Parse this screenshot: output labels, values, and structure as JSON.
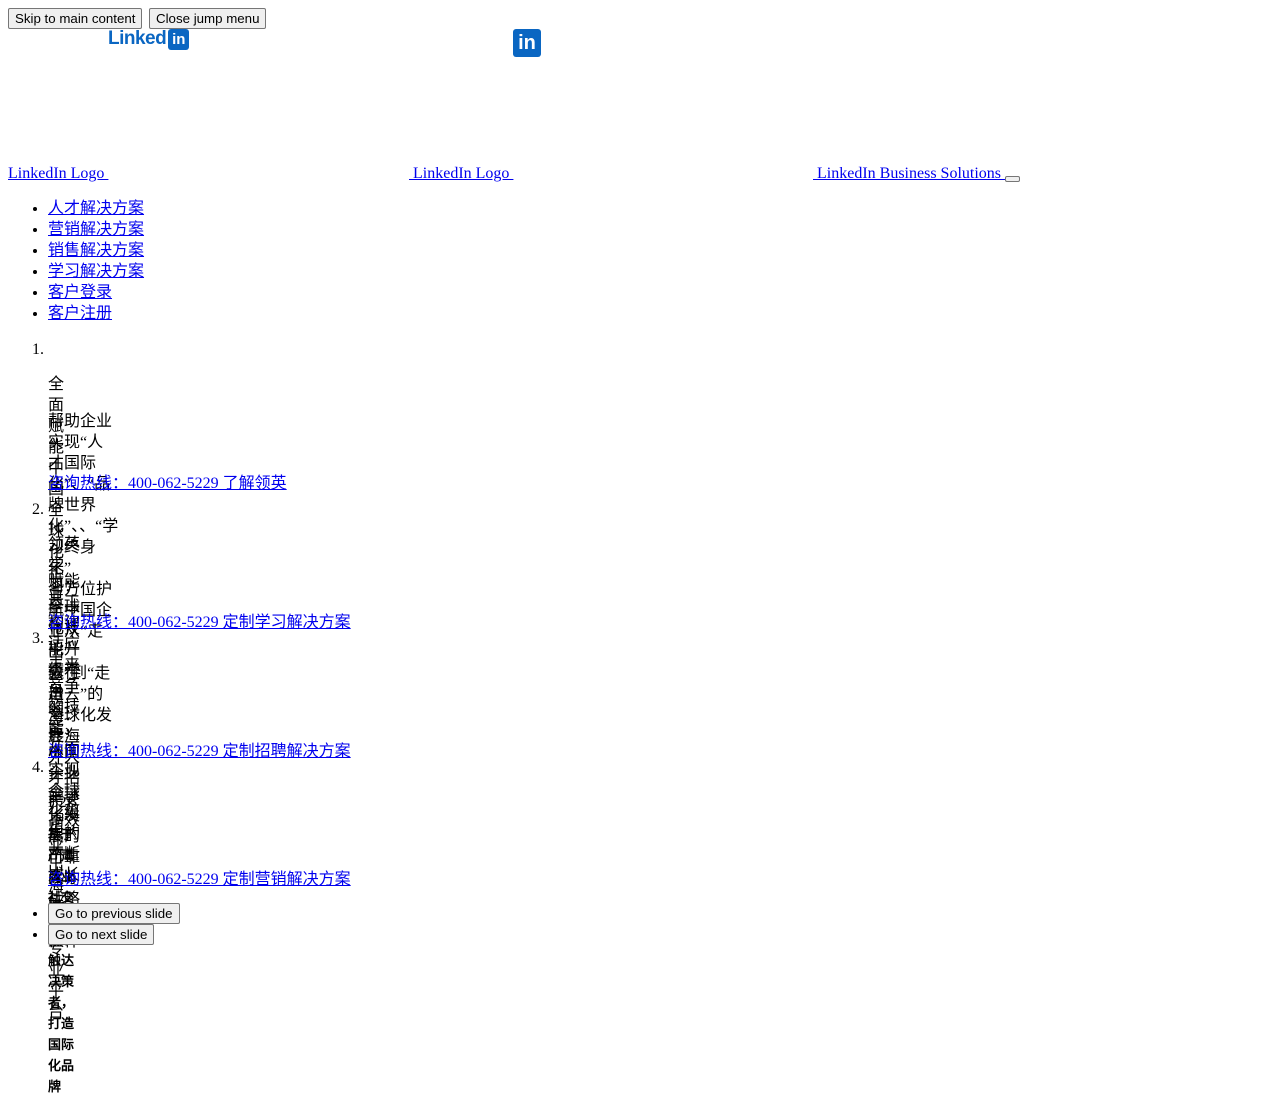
{
  "top_buttons": {
    "skip": "Skip to main content",
    "close_jump": "Close jump menu"
  },
  "brand": {
    "wordmark_text": "Linked",
    "wordmark_in": "in",
    "icon_in": "in",
    "color": "#0a66c2"
  },
  "logo_links": [
    "LinkedIn Logo ",
    " LinkedIn Logo ",
    " LinkedIn Business Solutions "
  ],
  "nav": [
    "人才解决方案",
    "营销解决方案",
    "销售解决方案",
    "学习解决方案",
    "客户登录",
    "客户注册"
  ],
  "slides": [
    {
      "number": "1.",
      "heading": "全面赋能中国全球化企业",
      "desc_lines": [
        "帮助企业实现“人才国际化”、“品牌世界化”、、“学习终身化”",
        "全方位护航中国企业从“走出去”到“走进去”的全球化发展"
      ],
      "cta": "咨询热线：400-062-5229 了解领英"
    },
    {
      "number": "2.",
      "heading": "领英学习：全球化技能升级平台",
      "desc_lines": [
        "赋能员工构建适应未来竞争的技能，从而实现全球化组织的不断成长"
      ],
      "cta": "咨询热线：400-062-5229 定制学习解决方案"
    },
    {
      "number": "3.",
      "heading": "赢在出海：让海外人才招聘更高效",
      "desc_lines": [
        "领英，中国企业全球化发展的可靠人才战略合作伙伴"
      ],
      "cta": "咨询热线：400-062-5229 定制招聘解决方案"
    },
    {
      "number": "4.",
      "heading": "B2B企业出海营销专业平台",
      "desc_lines": [
        "基于严肃商业社交环境精准触达决策者，打造国际化品牌"
      ],
      "cta": "咨询热线：400-062-5229 定制营销解决方案"
    }
  ],
  "slider_controls": {
    "prev": "Go to previous slide",
    "next": "Go to next slide"
  }
}
